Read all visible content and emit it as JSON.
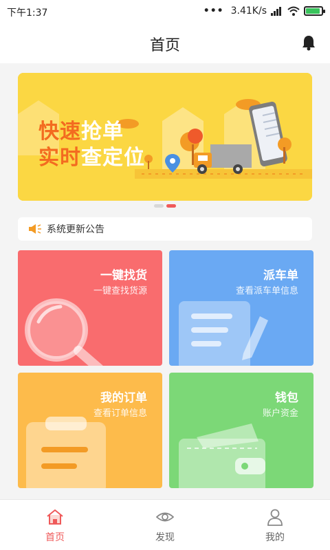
{
  "status_bar": {
    "time": "下午1:37",
    "dots": "•••",
    "speed": "3.41K/s",
    "icons": [
      "signal-icon",
      "wifi-icon",
      "battery-charging-icon"
    ]
  },
  "header": {
    "title": "首页",
    "right_icon": "bell-icon"
  },
  "banner": {
    "line1_highlight": "快速",
    "line1_rest": "抢单",
    "line2_highlight": "实时",
    "line2_rest": "查定位",
    "pager": {
      "total": 2,
      "active_index": 1
    }
  },
  "notice": {
    "icon": "speaker-icon",
    "text": "系统更新公告"
  },
  "cards": [
    {
      "title": "一键找货",
      "subtitle": "一键查找货源",
      "icon": "magnifier-icon",
      "color": "#f96c6e"
    },
    {
      "title": "派车单",
      "subtitle": "查看派车单信息",
      "icon": "document-pen-icon",
      "color": "#6aa9f3"
    },
    {
      "title": "我的订单",
      "subtitle": "查看订单信息",
      "icon": "clipboard-icon",
      "color": "#fdbb4b"
    },
    {
      "title": "钱包",
      "subtitle": "账户资金",
      "icon": "wallet-icon",
      "color": "#7cd877"
    }
  ],
  "bottom_nav": {
    "items": [
      {
        "label": "首页",
        "icon": "home-icon",
        "active": true
      },
      {
        "label": "发现",
        "icon": "eye-icon",
        "active": false
      },
      {
        "label": "我的",
        "icon": "user-icon",
        "active": false
      }
    ]
  },
  "colors": {
    "accent": "#ef5a5a",
    "banner_bg": "#fbd743",
    "banner_highlight": "#f36b20"
  }
}
